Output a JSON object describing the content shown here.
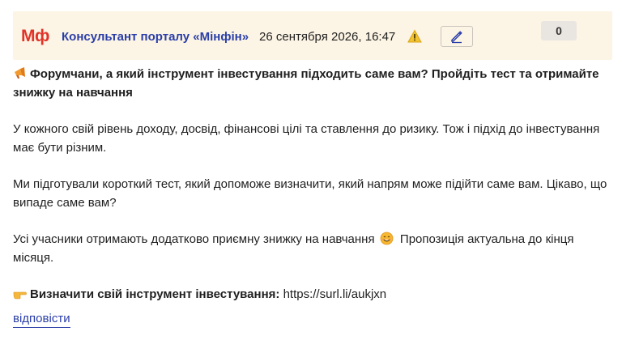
{
  "header": {
    "logo_text": "Мф",
    "author": "Консультант порталу «Мінфін»",
    "datetime": "26 сентября 2026, 16:47",
    "score": "0"
  },
  "icons": {
    "warning": "warning-icon",
    "edit": "pencil-icon",
    "title": "megaphone-icon",
    "smile": "smiling-face-icon",
    "pointer": "pointing-right-hand-icon"
  },
  "post": {
    "title": "Форумчани, а який інструмент інвестування підходить саме вам? Пройдіть тест та отримайте знижку на навчання",
    "paragraph1": "У кожного свій рівень доходу, досвід, фінансові цілі та ставлення до ризику. Тож і підхід до інвестування має бути різним.",
    "paragraph2": "Ми підготували короткий тест, який допоможе визначити, який напрям може підійти саме вам. Цікаво, що випаде саме вам?",
    "paragraph3_part1": "Усі учасники отримають додатково приємну знижку на навчання",
    "paragraph3_part2": "Пропозиція актуальна до кінця місяця.",
    "cta_label": "Визначити свій інструмент інвестування:",
    "cta_url": "https://surl.li/aukjxn"
  },
  "actions": {
    "reply_label": "відповісти"
  },
  "colors": {
    "header_bg": "#fcf4e4",
    "author_link": "#2a3ea8",
    "logo_red": "#e0342a"
  }
}
